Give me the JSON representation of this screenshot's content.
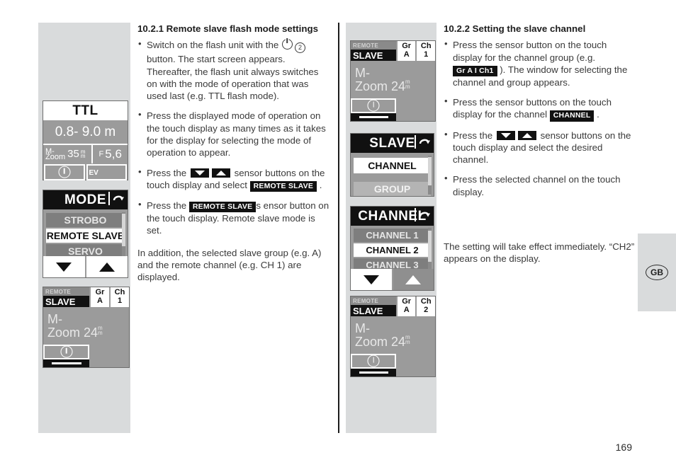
{
  "page": {
    "number": "169"
  },
  "lang_tab": {
    "label": "GB"
  },
  "left_section": {
    "heading": "10.2.1 Remote slave flash mode settings",
    "bullets": [
      {
        "parts": [
          {
            "t": "text",
            "v": "Switch on the flash unit with the "
          },
          {
            "t": "icon",
            "v": "power-icon"
          },
          {
            "t": "icon",
            "v": "circled-two-icon"
          },
          {
            "t": "text",
            "v": " button. The start screen appears. Thereafter, the flash unit always switches on with the mode of operation that was used last (e.g. TTL flash mode)."
          }
        ]
      },
      {
        "parts": [
          {
            "t": "text",
            "v": "Press the displayed mode of operation on the touch display as many times as it takes for the display for selecting the mode of operation to appear."
          }
        ]
      },
      {
        "parts": [
          {
            "t": "text",
            "v": "Press the "
          },
          {
            "t": "icon",
            "v": "down-sensor-button-icon"
          },
          {
            "t": "icon",
            "v": "up-sensor-button-icon"
          },
          {
            "t": "text",
            "v": " sensor buttons on the touch display and select "
          },
          {
            "t": "badge",
            "v": "REMOTE SLAVE"
          },
          {
            "t": "text",
            "v": " ."
          }
        ]
      },
      {
        "parts": [
          {
            "t": "text",
            "v": "Press the "
          },
          {
            "t": "badge",
            "v": "REMOTE SLAVE"
          },
          {
            "t": "text",
            "v": "s ensor button on the touch display. Remote slave mode is set."
          }
        ]
      }
    ],
    "closing": "In addition, the selected slave group (e.g. A) and the remote channel (e.g. CH 1) are displayed."
  },
  "right_section": {
    "heading": "10.2.2 Setting the slave channel",
    "bullets": [
      {
        "parts": [
          {
            "t": "text",
            "v": "Press the sensor button on the touch display for the channel group (e.g. "
          },
          {
            "t": "badge",
            "v": "Gr A I Ch1"
          },
          {
            "t": "text",
            "v": " ). The window for selecting the channel and group appears."
          }
        ]
      },
      {
        "parts": [
          {
            "t": "text",
            "v": "Press the sensor buttons on the touch display for the channel "
          },
          {
            "t": "badge",
            "v": "CHANNEL"
          },
          {
            "t": "text",
            "v": " ."
          }
        ]
      },
      {
        "parts": [
          {
            "t": "text",
            "v": "Press the "
          },
          {
            "t": "icon",
            "v": "down-sensor-button-icon"
          },
          {
            "t": "icon",
            "v": "up-sensor-button-icon"
          },
          {
            "t": "text",
            "v": " sensor buttons on the touch display and select the desired channel."
          }
        ]
      },
      {
        "parts": [
          {
            "t": "text",
            "v": "Press the selected channel on the touch display."
          }
        ]
      }
    ],
    "closing": "The setting will take effect immediately. “CH2” appears on the display."
  },
  "ttl_display": {
    "mode": "TTL",
    "distance": "0.8- 9.0 m",
    "zoom_label": "M-\nZoom",
    "zoom_label_line1": "M-",
    "zoom_label_line2": "Zoom",
    "zoom_value": "35",
    "zoom_unit": "m\nm",
    "aperture_label": "F",
    "aperture_value": "5,6",
    "ev_label": "EV",
    "light_icon": "exposure-ok-icon"
  },
  "mode_menu": {
    "title": "MODE",
    "back_icon": "return-arrow-icon",
    "items": [
      {
        "label": "STROBO",
        "state": "dim"
      },
      {
        "label": "REMOTE SLAVE",
        "state": "selected"
      },
      {
        "label": "SERVO",
        "state": "dim"
      }
    ],
    "down_button": "down-arrow-button",
    "up_button": "up-arrow-button"
  },
  "slave_display_left": {
    "remote_label": "REMOTE",
    "slave_label": "SLAVE",
    "group_header": "Gr",
    "group_value": "A",
    "channel_header": "Ch",
    "channel_value": "1",
    "zoom_line1": "M-",
    "zoom_line2": "Zoom 24",
    "zoom_unit": "mm"
  },
  "slave_display_mid_top": {
    "remote_label": "REMOTE",
    "slave_label": "SLAVE",
    "group_header": "Gr",
    "group_value": "A",
    "channel_header": "Ch",
    "channel_value": "1",
    "zoom_line1": "M-",
    "zoom_line2": "Zoom 24",
    "zoom_unit": "mm"
  },
  "slave_display_mid_bottom": {
    "remote_label": "REMOTE",
    "slave_label": "SLAVE",
    "group_header": "Gr",
    "group_value": "A",
    "channel_header": "Ch",
    "channel_value": "2",
    "zoom_line1": "M-",
    "zoom_line2": "Zoom 24",
    "zoom_unit": "mm"
  },
  "slave_menu": {
    "title": "SLAVE",
    "back_icon": "return-arrow-icon",
    "items": [
      {
        "label": "CHANNEL",
        "state": "selected"
      },
      {
        "label": "GROUP",
        "state": "light"
      }
    ]
  },
  "channel_menu": {
    "title": "CHANNEL",
    "back_icon": "return-arrow-icon",
    "items": [
      {
        "label": "CHANNEL 1",
        "state": "dim"
      },
      {
        "label": "CHANNEL 2",
        "state": "selected"
      },
      {
        "label": "CHANNEL 3",
        "state": "dim"
      }
    ],
    "down_button": "down-arrow-button",
    "up_button": "up-arrow-button"
  },
  "colors": {
    "figure_bg": "#d9dbdc",
    "lcd_bg": "#9b9b9b",
    "lcd_dark": "#111111",
    "lcd_white": "#ffffff"
  }
}
